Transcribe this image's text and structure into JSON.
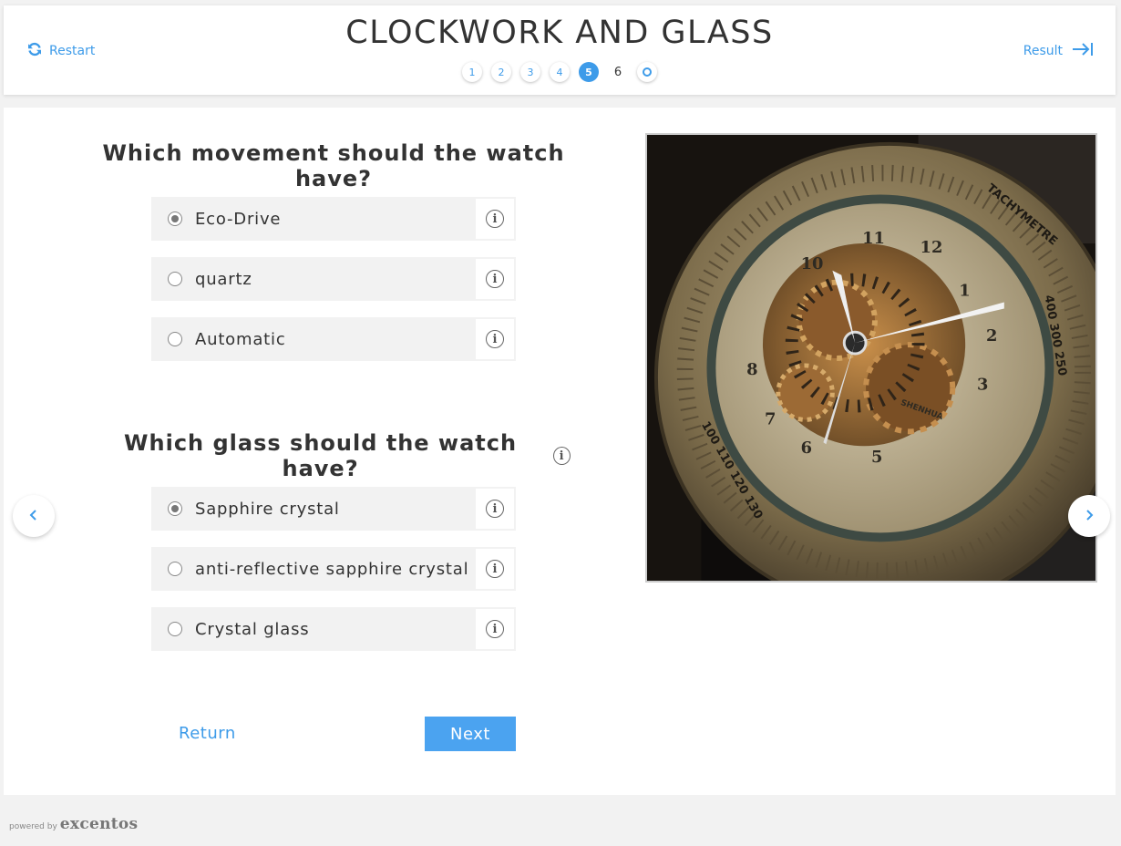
{
  "header": {
    "title": "CLOCKWORK AND GLASS",
    "restart_label": "Restart",
    "result_label": "Result",
    "steps": [
      "1",
      "2",
      "3",
      "4",
      "5",
      "6"
    ],
    "current_step": 5
  },
  "questions": [
    {
      "text": "Which movement should the watch have?",
      "options": [
        {
          "label": "Eco-Drive",
          "selected": true
        },
        {
          "label": "quartz",
          "selected": false
        },
        {
          "label": "Automatic",
          "selected": false
        }
      ]
    },
    {
      "text": "Which glass should the watch have?",
      "options": [
        {
          "label": "Sapphire crystal",
          "selected": true
        },
        {
          "label": "anti-reflective sapphire crystal",
          "selected": false
        },
        {
          "label": "Crystal glass",
          "selected": false
        }
      ]
    }
  ],
  "nav": {
    "return_label": "Return",
    "next_label": "Next"
  },
  "footer": {
    "powered_by": "powered by",
    "brand": "excentos"
  },
  "colors": {
    "accent": "#3d9be9",
    "button": "#4ba3f0",
    "option_bg": "#f2f2f2"
  }
}
